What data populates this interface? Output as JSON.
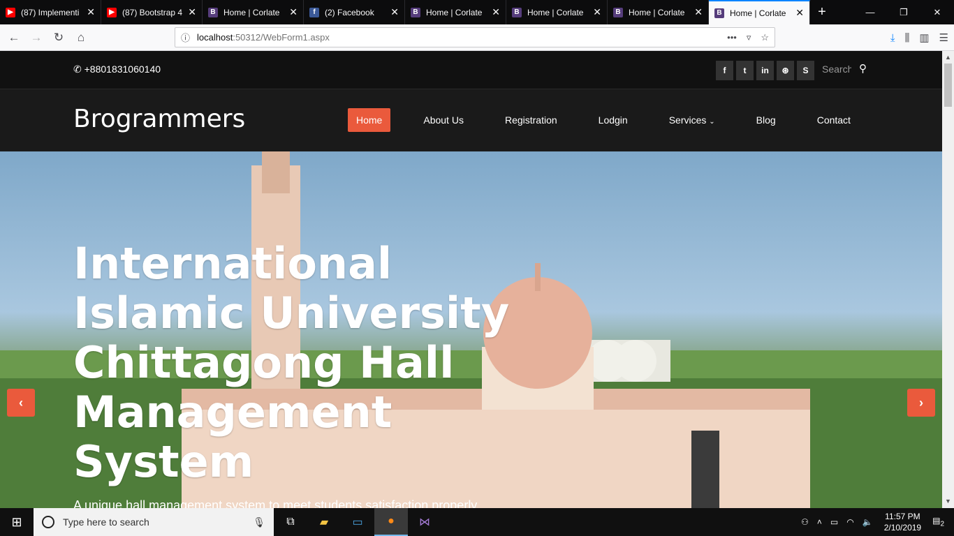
{
  "browser": {
    "tabs": [
      {
        "title": "(87) Implementi",
        "favicon": "youtube-icon"
      },
      {
        "title": "(87) Bootstrap 4",
        "favicon": "youtube-icon"
      },
      {
        "title": "Home | Corlate",
        "favicon": "bootstrap-icon"
      },
      {
        "title": "(2) Facebook",
        "favicon": "facebook-icon"
      },
      {
        "title": "Home | Corlate",
        "favicon": "bootstrap-icon"
      },
      {
        "title": "Home | Corlate",
        "favicon": "bootstrap-icon"
      },
      {
        "title": "Home | Corlate",
        "favicon": "bootstrap-icon"
      },
      {
        "title": "Home | Corlate",
        "favicon": "bootstrap-icon",
        "active": true
      }
    ],
    "url_host": "localhost",
    "url_path": ":50312/WebForm1.aspx"
  },
  "site": {
    "phone": "+8801831060140",
    "search_placeholder": "Search",
    "brand": "Brogrammers",
    "menu": [
      "Home",
      "About Us",
      "Registration",
      "Lodgin",
      "Services",
      "Blog",
      "Contact"
    ],
    "headline": "International Islamic University Chittagong Hall Management System",
    "subheadline": "A unique hall management system to meet students satisfaction properly",
    "accent_color": "#ea5a3c"
  },
  "taskbar": {
    "search_placeholder": "Type here to search",
    "time": "11:57 PM",
    "date": "2/10/2019",
    "notifications": "2"
  }
}
